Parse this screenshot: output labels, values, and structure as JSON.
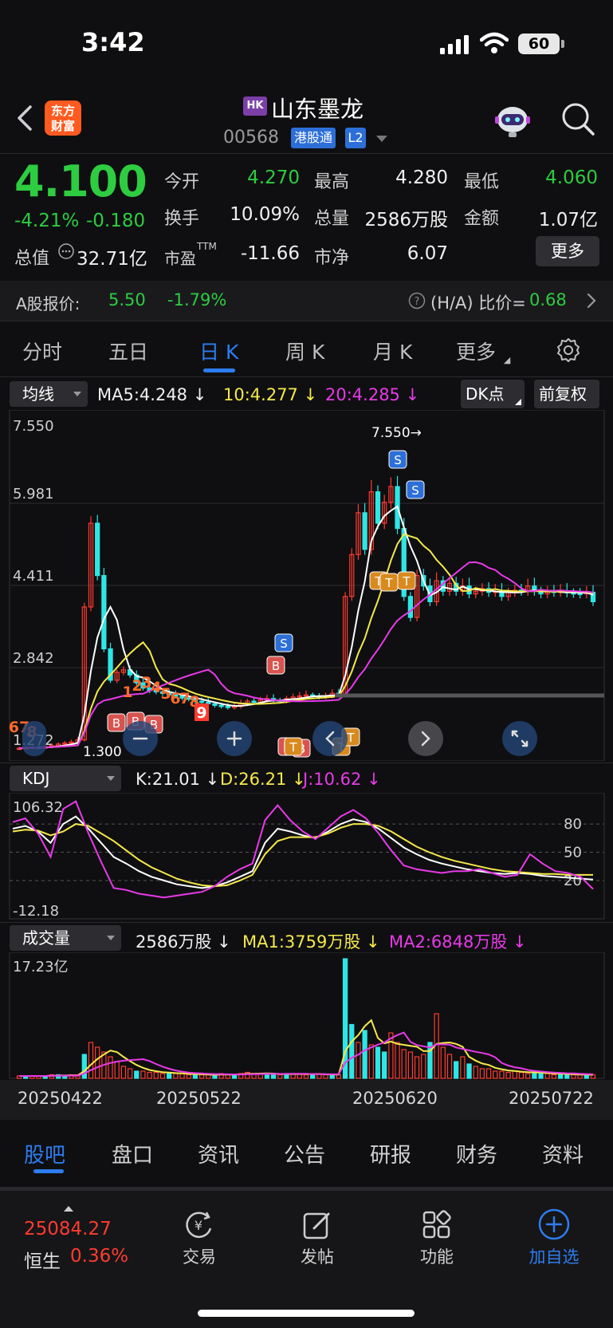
{
  "status_bar": {
    "time": "3:42",
    "battery": "60"
  },
  "header": {
    "brand_logo_line1": "东方",
    "brand_logo_line2": "财富",
    "market_badge": "HK",
    "stock_name": "山东墨龙",
    "stock_code": "00568",
    "connect_tag": "港股通",
    "level_tag": "L2"
  },
  "quote": {
    "price": "4.100",
    "change_pct": "-4.21%",
    "change_abs": "-0.180",
    "open_label": "今开",
    "open": "4.270",
    "high_label": "最高",
    "high": "4.280",
    "low_label": "最低",
    "low": "4.060",
    "turnover_label": "换手",
    "turnover": "10.09%",
    "volume_label": "总量",
    "volume": "2586万股",
    "amount_label": "金额",
    "amount": "1.07亿",
    "mktcap_label": "总值",
    "mktcap": "32.71亿",
    "pe_label": "市盈",
    "pe_sup": "TTM",
    "pe": "-11.66",
    "pb_label": "市净",
    "pb": "6.07",
    "more_label": "更多",
    "colors": {
      "up": "#ff3b30",
      "down": "#2ecc40"
    }
  },
  "ashare": {
    "label": "A股报价:",
    "price": "5.50",
    "change": "-1.79%",
    "ha_label": "(H/A) 比价=",
    "ha_value": "0.68"
  },
  "period_tabs": [
    "分时",
    "五日",
    "日 K",
    "周 K",
    "月 K",
    "更多"
  ],
  "active_period": "日 K",
  "main_chart": {
    "indicator_select": "均线",
    "ma5": "MA5:4.248 ↓",
    "ma10": "10:4.277 ↓",
    "ma20": "20:4.285 ↓",
    "dk_label": "DK点",
    "adjust_label": "前复权",
    "y_labels": [
      "7.550",
      "5.981",
      "4.411",
      "2.842",
      "1.272"
    ],
    "max_marker": "7.550→",
    "min_marker": "1.300",
    "signal_nums": [
      "67",
      "8",
      "1",
      "2",
      "3",
      "4",
      "5",
      "6",
      "7",
      "8",
      "9"
    ],
    "signal_letters": {
      "buy": "B",
      "sell": "S",
      "tag": "T"
    },
    "controls": [
      "minus-button",
      "plus-button",
      "left-button",
      "right-button",
      "fullscreen-button"
    ],
    "colors": {
      "ma5": "#ffffff",
      "ma10": "#f5e94a",
      "ma20": "#e83ae8",
      "up": "#ff3b30",
      "down": "#2ee6e6"
    }
  },
  "kdj": {
    "select": "KDJ",
    "k": "K:21.01 ↓",
    "d": "D:26.21 ↓",
    "j": "J:10.62 ↓",
    "y_top": "106.32",
    "y_bottom": "-12.18",
    "levels": [
      "80",
      "50",
      "20"
    ]
  },
  "volume": {
    "select": "成交量",
    "vol": "2586万股 ↓",
    "ma1": "MA1:3759万股 ↓",
    "ma2": "MA2:6848万股 ↓",
    "y_top": "17.23亿",
    "dates": [
      "20250422",
      "20250522",
      "20250620",
      "20250722"
    ]
  },
  "bottom_tabs": [
    "股吧",
    "盘口",
    "资讯",
    "公告",
    "研报",
    "财务",
    "资料"
  ],
  "active_bottom_tab": "股吧",
  "dock": {
    "index_value": "25084.27",
    "index_name": "恒生",
    "index_change": "0.36%",
    "items": [
      "交易",
      "发帖",
      "功能",
      "加自选"
    ]
  }
}
